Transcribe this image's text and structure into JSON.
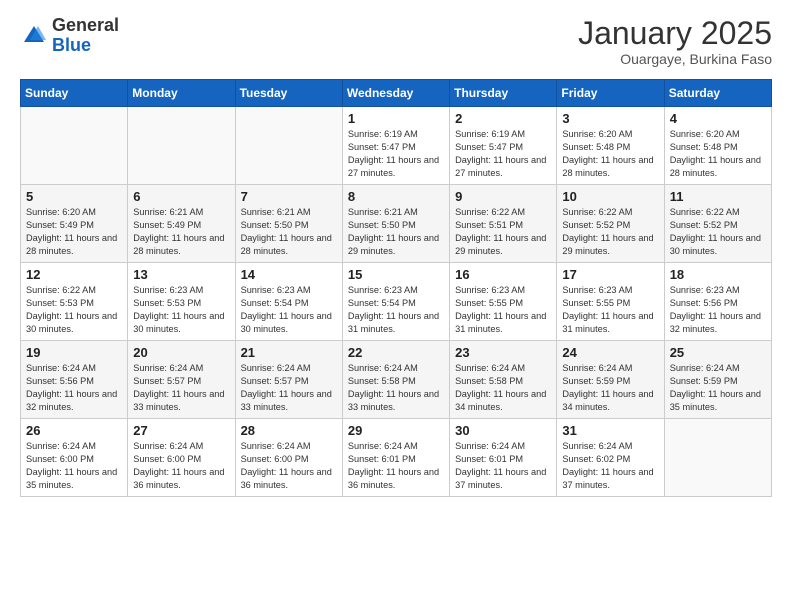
{
  "header": {
    "logo_general": "General",
    "logo_blue": "Blue",
    "month_title": "January 2025",
    "subtitle": "Ouargaye, Burkina Faso"
  },
  "days_of_week": [
    "Sunday",
    "Monday",
    "Tuesday",
    "Wednesday",
    "Thursday",
    "Friday",
    "Saturday"
  ],
  "weeks": [
    [
      {
        "day": "",
        "sunrise": "",
        "sunset": "",
        "daylight": ""
      },
      {
        "day": "",
        "sunrise": "",
        "sunset": "",
        "daylight": ""
      },
      {
        "day": "",
        "sunrise": "",
        "sunset": "",
        "daylight": ""
      },
      {
        "day": "1",
        "sunrise": "Sunrise: 6:19 AM",
        "sunset": "Sunset: 5:47 PM",
        "daylight": "Daylight: 11 hours and 27 minutes."
      },
      {
        "day": "2",
        "sunrise": "Sunrise: 6:19 AM",
        "sunset": "Sunset: 5:47 PM",
        "daylight": "Daylight: 11 hours and 27 minutes."
      },
      {
        "day": "3",
        "sunrise": "Sunrise: 6:20 AM",
        "sunset": "Sunset: 5:48 PM",
        "daylight": "Daylight: 11 hours and 28 minutes."
      },
      {
        "day": "4",
        "sunrise": "Sunrise: 6:20 AM",
        "sunset": "Sunset: 5:48 PM",
        "daylight": "Daylight: 11 hours and 28 minutes."
      }
    ],
    [
      {
        "day": "5",
        "sunrise": "Sunrise: 6:20 AM",
        "sunset": "Sunset: 5:49 PM",
        "daylight": "Daylight: 11 hours and 28 minutes."
      },
      {
        "day": "6",
        "sunrise": "Sunrise: 6:21 AM",
        "sunset": "Sunset: 5:49 PM",
        "daylight": "Daylight: 11 hours and 28 minutes."
      },
      {
        "day": "7",
        "sunrise": "Sunrise: 6:21 AM",
        "sunset": "Sunset: 5:50 PM",
        "daylight": "Daylight: 11 hours and 28 minutes."
      },
      {
        "day": "8",
        "sunrise": "Sunrise: 6:21 AM",
        "sunset": "Sunset: 5:50 PM",
        "daylight": "Daylight: 11 hours and 29 minutes."
      },
      {
        "day": "9",
        "sunrise": "Sunrise: 6:22 AM",
        "sunset": "Sunset: 5:51 PM",
        "daylight": "Daylight: 11 hours and 29 minutes."
      },
      {
        "day": "10",
        "sunrise": "Sunrise: 6:22 AM",
        "sunset": "Sunset: 5:52 PM",
        "daylight": "Daylight: 11 hours and 29 minutes."
      },
      {
        "day": "11",
        "sunrise": "Sunrise: 6:22 AM",
        "sunset": "Sunset: 5:52 PM",
        "daylight": "Daylight: 11 hours and 30 minutes."
      }
    ],
    [
      {
        "day": "12",
        "sunrise": "Sunrise: 6:22 AM",
        "sunset": "Sunset: 5:53 PM",
        "daylight": "Daylight: 11 hours and 30 minutes."
      },
      {
        "day": "13",
        "sunrise": "Sunrise: 6:23 AM",
        "sunset": "Sunset: 5:53 PM",
        "daylight": "Daylight: 11 hours and 30 minutes."
      },
      {
        "day": "14",
        "sunrise": "Sunrise: 6:23 AM",
        "sunset": "Sunset: 5:54 PM",
        "daylight": "Daylight: 11 hours and 30 minutes."
      },
      {
        "day": "15",
        "sunrise": "Sunrise: 6:23 AM",
        "sunset": "Sunset: 5:54 PM",
        "daylight": "Daylight: 11 hours and 31 minutes."
      },
      {
        "day": "16",
        "sunrise": "Sunrise: 6:23 AM",
        "sunset": "Sunset: 5:55 PM",
        "daylight": "Daylight: 11 hours and 31 minutes."
      },
      {
        "day": "17",
        "sunrise": "Sunrise: 6:23 AM",
        "sunset": "Sunset: 5:55 PM",
        "daylight": "Daylight: 11 hours and 31 minutes."
      },
      {
        "day": "18",
        "sunrise": "Sunrise: 6:23 AM",
        "sunset": "Sunset: 5:56 PM",
        "daylight": "Daylight: 11 hours and 32 minutes."
      }
    ],
    [
      {
        "day": "19",
        "sunrise": "Sunrise: 6:24 AM",
        "sunset": "Sunset: 5:56 PM",
        "daylight": "Daylight: 11 hours and 32 minutes."
      },
      {
        "day": "20",
        "sunrise": "Sunrise: 6:24 AM",
        "sunset": "Sunset: 5:57 PM",
        "daylight": "Daylight: 11 hours and 33 minutes."
      },
      {
        "day": "21",
        "sunrise": "Sunrise: 6:24 AM",
        "sunset": "Sunset: 5:57 PM",
        "daylight": "Daylight: 11 hours and 33 minutes."
      },
      {
        "day": "22",
        "sunrise": "Sunrise: 6:24 AM",
        "sunset": "Sunset: 5:58 PM",
        "daylight": "Daylight: 11 hours and 33 minutes."
      },
      {
        "day": "23",
        "sunrise": "Sunrise: 6:24 AM",
        "sunset": "Sunset: 5:58 PM",
        "daylight": "Daylight: 11 hours and 34 minutes."
      },
      {
        "day": "24",
        "sunrise": "Sunrise: 6:24 AM",
        "sunset": "Sunset: 5:59 PM",
        "daylight": "Daylight: 11 hours and 34 minutes."
      },
      {
        "day": "25",
        "sunrise": "Sunrise: 6:24 AM",
        "sunset": "Sunset: 5:59 PM",
        "daylight": "Daylight: 11 hours and 35 minutes."
      }
    ],
    [
      {
        "day": "26",
        "sunrise": "Sunrise: 6:24 AM",
        "sunset": "Sunset: 6:00 PM",
        "daylight": "Daylight: 11 hours and 35 minutes."
      },
      {
        "day": "27",
        "sunrise": "Sunrise: 6:24 AM",
        "sunset": "Sunset: 6:00 PM",
        "daylight": "Daylight: 11 hours and 36 minutes."
      },
      {
        "day": "28",
        "sunrise": "Sunrise: 6:24 AM",
        "sunset": "Sunset: 6:00 PM",
        "daylight": "Daylight: 11 hours and 36 minutes."
      },
      {
        "day": "29",
        "sunrise": "Sunrise: 6:24 AM",
        "sunset": "Sunset: 6:01 PM",
        "daylight": "Daylight: 11 hours and 36 minutes."
      },
      {
        "day": "30",
        "sunrise": "Sunrise: 6:24 AM",
        "sunset": "Sunset: 6:01 PM",
        "daylight": "Daylight: 11 hours and 37 minutes."
      },
      {
        "day": "31",
        "sunrise": "Sunrise: 6:24 AM",
        "sunset": "Sunset: 6:02 PM",
        "daylight": "Daylight: 11 hours and 37 minutes."
      },
      {
        "day": "",
        "sunrise": "",
        "sunset": "",
        "daylight": ""
      }
    ]
  ]
}
